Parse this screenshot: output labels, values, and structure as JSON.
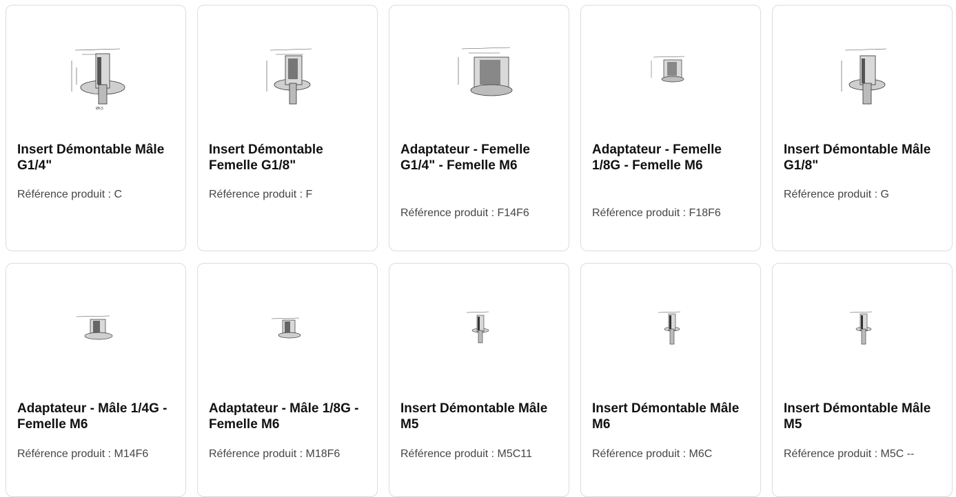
{
  "products": [
    {
      "title": "Insert Démontable Mâle G1/4\"",
      "ref": "Référence produit : C",
      "icon": "male-insert-drawing-icon"
    },
    {
      "title": "Insert Démontable Femelle G1/8\"",
      "ref": "Référence produit : F",
      "icon": "female-insert-drawing-icon"
    },
    {
      "title": "Adaptateur - Femelle G1/4\" - Femelle M6",
      "ref": "Référence produit : F14F6",
      "icon": "adapter-drawing-icon"
    },
    {
      "title": "Adaptateur - Femelle 1/8G - Femelle M6",
      "ref": "Référence produit : F18F6",
      "icon": "adapter-drawing-icon"
    },
    {
      "title": "Insert Démontable Mâle G1/8\"",
      "ref": "Référence produit : G",
      "icon": "male-insert-drawing-icon"
    },
    {
      "title": "Adaptateur - Mâle 1/4G - Femelle M6",
      "ref": "Référence produit : M14F6",
      "icon": "adapter-drawing-icon"
    },
    {
      "title": "Adaptateur - Mâle 1/8G - Femelle M6",
      "ref": "Référence produit : M18F6",
      "icon": "adapter-drawing-icon"
    },
    {
      "title": "Insert Démontable Mâle M5",
      "ref": "Référence produit : M5C11",
      "icon": "male-insert-drawing-icon"
    },
    {
      "title": "Insert Démontable Mâle M6",
      "ref": "Référence produit : M6C",
      "icon": "male-insert-drawing-icon"
    },
    {
      "title": "Insert Démontable Mâle M5",
      "ref": "Référence produit : M5C --",
      "icon": "male-insert-drawing-icon"
    }
  ],
  "colors": {
    "border": "#dcdcdc",
    "title": "#111111",
    "ref": "#444444"
  }
}
